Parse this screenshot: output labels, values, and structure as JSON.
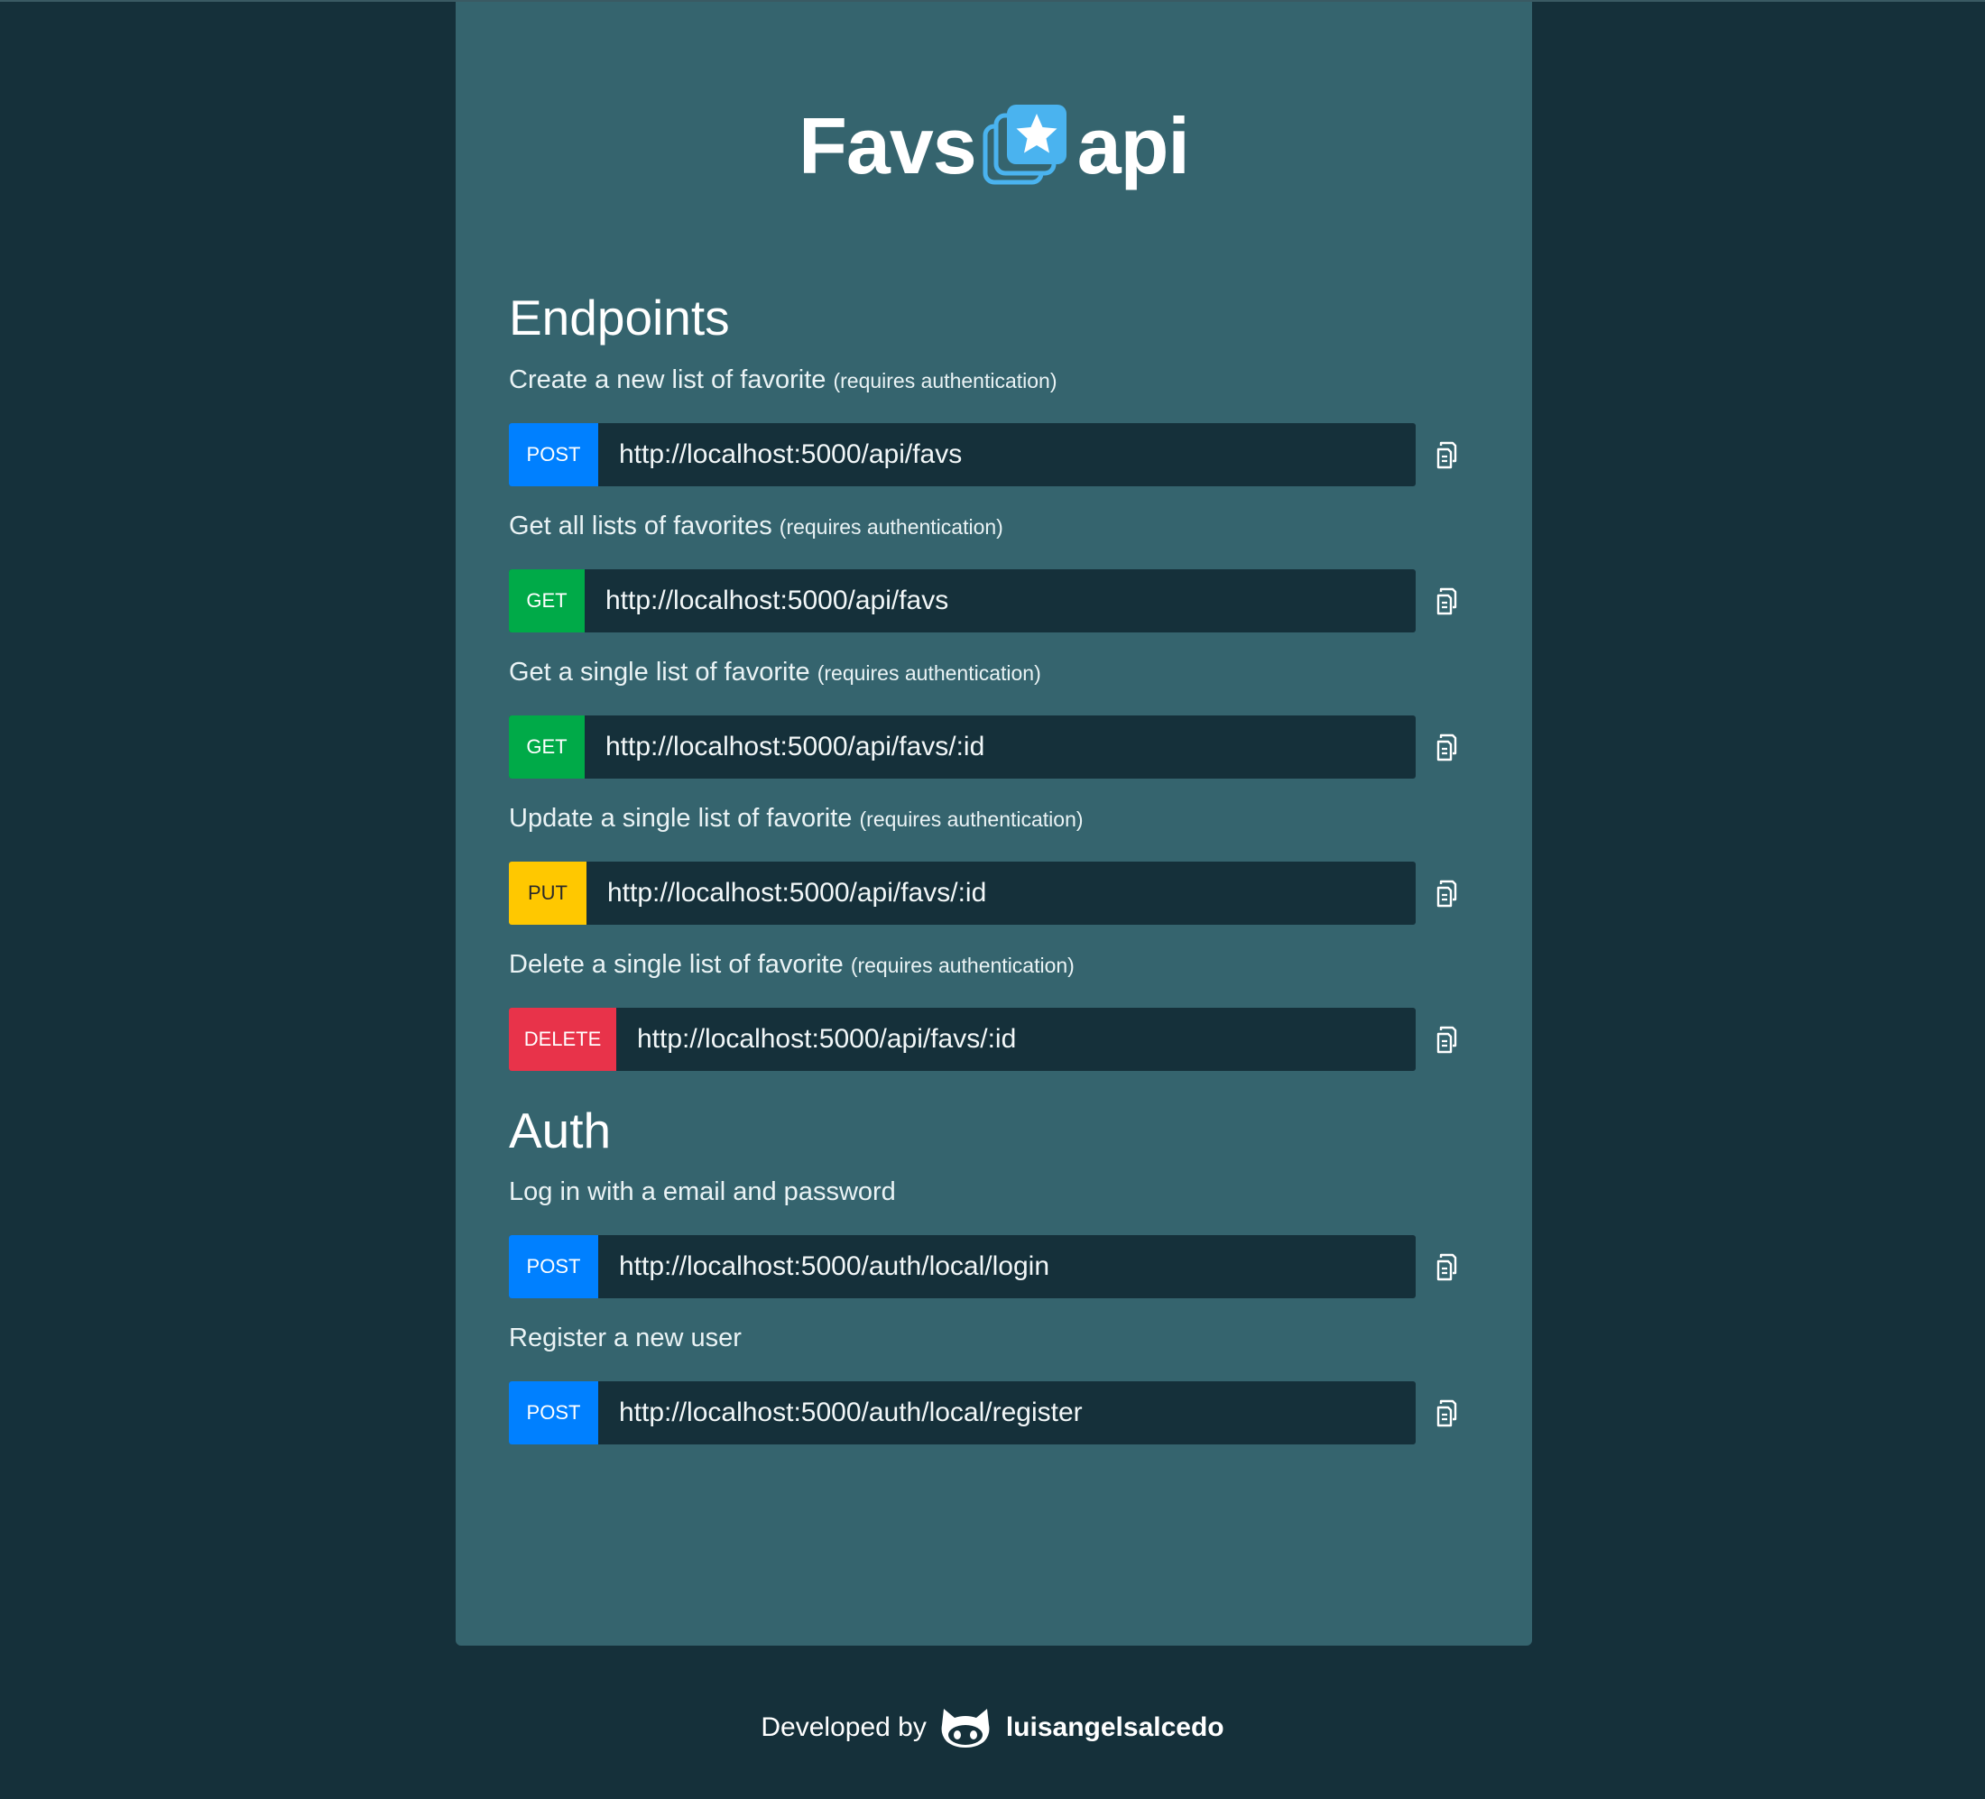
{
  "logo": {
    "left_text": "Favs",
    "right_text": "api"
  },
  "sections": {
    "endpoints_title": "Endpoints",
    "auth_title": "Auth"
  },
  "endpoints": [
    {
      "description": "Create a new list of favorite",
      "note": "(requires authentication)",
      "method": "POST",
      "url": "http://localhost:5000/api/favs"
    },
    {
      "description": "Get all lists of favorites",
      "note": "(requires authentication)",
      "method": "GET",
      "url": "http://localhost:5000/api/favs"
    },
    {
      "description": "Get a single list of favorite",
      "note": "(requires authentication)",
      "method": "GET",
      "url": "http://localhost:5000/api/favs/:id"
    },
    {
      "description": "Update a single list of favorite",
      "note": "(requires authentication)",
      "method": "PUT",
      "url": "http://localhost:5000/api/favs/:id"
    },
    {
      "description": "Delete a single list of favorite",
      "note": "(requires authentication)",
      "method": "DELETE",
      "url": "http://localhost:5000/api/favs/:id"
    }
  ],
  "auth": [
    {
      "description": "Log in with a email and password",
      "method": "POST",
      "url": "http://localhost:5000/auth/local/login"
    },
    {
      "description": "Register a new user",
      "method": "POST",
      "url": "http://localhost:5000/auth/local/register"
    }
  ],
  "footer": {
    "prefix": "Developed by",
    "username": "luisangelsalcedo"
  },
  "colors": {
    "background": "#15303a",
    "card": "#35646e",
    "post": "#0080ff",
    "get": "#00aa48",
    "put": "#ffc800",
    "delete": "#e8334a",
    "logo_accent": "#4ab3ef"
  },
  "icons": {
    "copy": "copy-icon",
    "logo": "favs-star-logo-icon",
    "github": "github-cat-icon"
  }
}
